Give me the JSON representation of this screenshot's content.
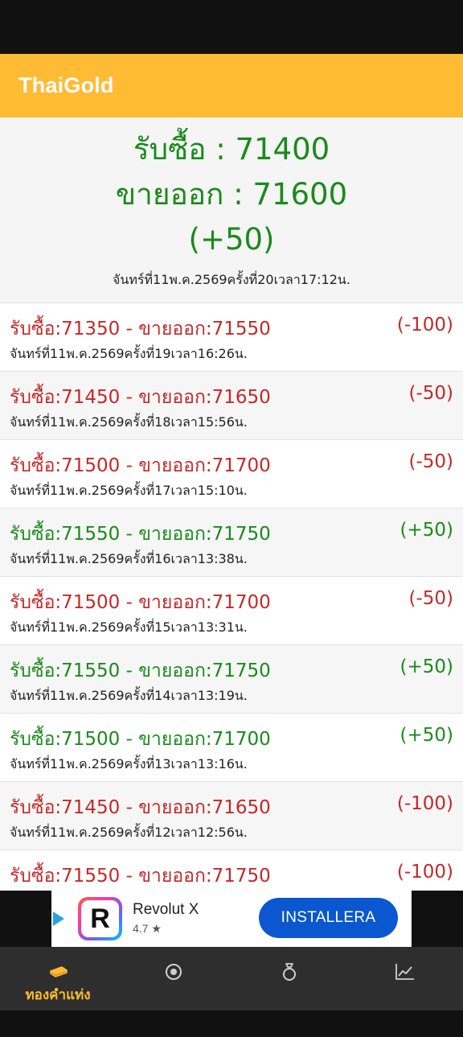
{
  "app": {
    "title": "ThaiGold"
  },
  "summary": {
    "buy": "รับซื้อ : 71400",
    "sell": "ขายออก : 71600",
    "change": "(+50)",
    "time": "จันทร์ที่11พ.ค.2569ครั้งที่20เวลา17:12น."
  },
  "history": [
    {
      "price": "รับซื้อ:71350 - ขายออก:71550",
      "change": "(-100)",
      "time": "จันทร์ที่11พ.ค.2569ครั้งที่19เวลา16:26น.",
      "trend": "down"
    },
    {
      "price": "รับซื้อ:71450 - ขายออก:71650",
      "change": "(-50)",
      "time": "จันทร์ที่11พ.ค.2569ครั้งที่18เวลา15:56น.",
      "trend": "down"
    },
    {
      "price": "รับซื้อ:71500 - ขายออก:71700",
      "change": "(-50)",
      "time": "จันทร์ที่11พ.ค.2569ครั้งที่17เวลา15:10น.",
      "trend": "down"
    },
    {
      "price": "รับซื้อ:71550 - ขายออก:71750",
      "change": "(+50)",
      "time": "จันทร์ที่11พ.ค.2569ครั้งที่16เวลา13:38น.",
      "trend": "up"
    },
    {
      "price": "รับซื้อ:71500 - ขายออก:71700",
      "change": "(-50)",
      "time": "จันทร์ที่11พ.ค.2569ครั้งที่15เวลา13:31น.",
      "trend": "down"
    },
    {
      "price": "รับซื้อ:71550 - ขายออก:71750",
      "change": "(+50)",
      "time": "จันทร์ที่11พ.ค.2569ครั้งที่14เวลา13:19น.",
      "trend": "up"
    },
    {
      "price": "รับซื้อ:71500 - ขายออก:71700",
      "change": "(+50)",
      "time": "จันทร์ที่11พ.ค.2569ครั้งที่13เวลา13:16น.",
      "trend": "up"
    },
    {
      "price": "รับซื้อ:71450 - ขายออก:71650",
      "change": "(-100)",
      "time": "จันทร์ที่11พ.ค.2569ครั้งที่12เวลา12:56น.",
      "trend": "down"
    },
    {
      "price": "รับซื้อ:71550 - ขายออก:71750",
      "change": "(-100)",
      "time": "",
      "trend": "down"
    }
  ],
  "ad": {
    "logo_letter": "R",
    "name": "Revolut X",
    "rating": "4.7 ★",
    "button": "INSTALLERA"
  },
  "nav": {
    "items": [
      {
        "icon": "gold-bar-icon",
        "label": "ทองคำแท่ง",
        "active": true
      },
      {
        "icon": "target-icon",
        "label": ""
      },
      {
        "icon": "ring-icon",
        "label": ""
      },
      {
        "icon": "trend-chart-icon",
        "label": ""
      }
    ]
  },
  "colors": {
    "accent": "#FEBB33",
    "up": "#1a8a1a",
    "down": "#c62828"
  }
}
